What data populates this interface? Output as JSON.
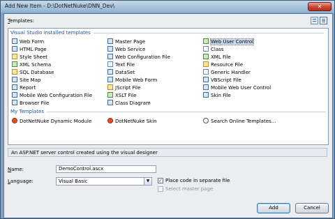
{
  "window": {
    "title": "Add New Item - D:\\DotNetNuke\\DNN_Dev\\",
    "close_glyph": "✕"
  },
  "templates_label": "Templates:",
  "templates_underline": "T",
  "templates_rest": "emplates:",
  "view_buttons": [
    {
      "name": "large-icons-view-icon",
      "icon": "large-icons"
    },
    {
      "name": "small-icons-view-icon",
      "icon": "small-icons"
    }
  ],
  "sections": {
    "installed": "Visual Studio installed templates",
    "my_templates": "My Templates"
  },
  "installed_columns": [
    [
      {
        "label": "Web Form",
        "icon": "page",
        "color": "blue"
      },
      {
        "label": "HTML Page",
        "icon": "page",
        "color": "blue"
      },
      {
        "label": "Style Sheet",
        "icon": "css",
        "color": "yellow"
      },
      {
        "label": "XML Schema",
        "icon": "xsd",
        "color": "green"
      },
      {
        "label": "SQL Database",
        "icon": "database",
        "color": "yellow"
      },
      {
        "label": "Site Map",
        "icon": "sitemap",
        "color": "blue"
      },
      {
        "label": "Report",
        "icon": "report",
        "color": "blue"
      },
      {
        "label": "Mobile Web Configuration File",
        "icon": "config",
        "color": "blue"
      },
      {
        "label": "Browser File",
        "icon": "browser",
        "color": "blue"
      }
    ],
    [
      {
        "label": "Master Page",
        "icon": "master",
        "color": "blue"
      },
      {
        "label": "Web Service",
        "icon": "webservice",
        "color": "blue"
      },
      {
        "label": "Web Configuration File",
        "icon": "config",
        "color": "blue"
      },
      {
        "label": "Text File",
        "icon": "text",
        "color": "plain"
      },
      {
        "label": "DataSet",
        "icon": "dataset",
        "color": "blue"
      },
      {
        "label": "Mobile Web Form",
        "icon": "mobile",
        "color": "blue"
      },
      {
        "label": "JScript File",
        "icon": "script",
        "color": "yellow"
      },
      {
        "label": "XSLT File",
        "icon": "xslt",
        "color": "green"
      },
      {
        "label": "Class Diagram",
        "icon": "diagram",
        "color": "blue"
      }
    ],
    [
      {
        "label": "Web User Control",
        "icon": "usercontrol",
        "color": "green",
        "selected": true
      },
      {
        "label": "Class",
        "icon": "class",
        "color": "plain"
      },
      {
        "label": "XML File",
        "icon": "xml",
        "color": "green"
      },
      {
        "label": "Resource File",
        "icon": "resource",
        "color": "yellow"
      },
      {
        "label": "Generic Handler",
        "icon": "handler",
        "color": "plain"
      },
      {
        "label": "VBScript File",
        "icon": "script",
        "color": "blue"
      },
      {
        "label": "Mobile Web User Control",
        "icon": "mobile",
        "color": "blue"
      },
      {
        "label": "Skin File",
        "icon": "skin",
        "color": "blue"
      }
    ]
  ],
  "my_templates": [
    {
      "label": "DotNetNuke Dynamic Module",
      "icon": "dotnetnuke",
      "color": "dnn"
    },
    {
      "label": "DotNetNuke Skin",
      "icon": "dotnetnuke",
      "color": "dnn"
    },
    {
      "label": "Search Online Templates...",
      "icon": "search",
      "color": "search"
    }
  ],
  "description": "An ASP.NET server control created using the visual designer",
  "name_field": {
    "label_accel": "N",
    "label_rest": "ame:",
    "value": "DemoControl.ascx"
  },
  "language_field": {
    "label_accel": "L",
    "label_rest": "anguage:",
    "value": "Visual Basic",
    "arrow": "▼"
  },
  "options": {
    "place_code": {
      "label": "Place code in separate file",
      "checked": true,
      "mark": "✓"
    },
    "master_page": {
      "label": "Select master page",
      "checked": false,
      "enabled": false
    }
  },
  "buttons": {
    "add": "Add",
    "cancel": "Cancel"
  }
}
